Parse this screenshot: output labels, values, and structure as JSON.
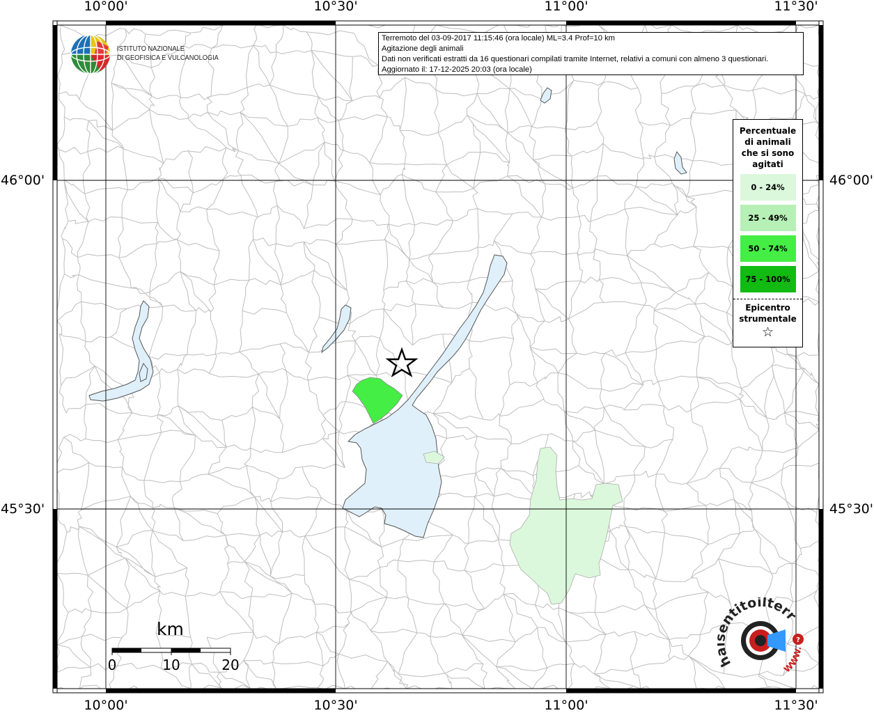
{
  "map": {
    "lon_labels": [
      "10°00'",
      "10°30'",
      "11°00'",
      "11°30'"
    ],
    "lat_labels": [
      "46°00'",
      "45°30'"
    ]
  },
  "info": {
    "line1": "Terremoto del 03-09-2017 11:15:46 (ora locale) ML=3.4 Prof=10 km",
    "line2": "Agitazione degli animali",
    "line3": "Dati non verificati estratti da 16 questionari compilati tramite Internet, relativi a comuni con almeno 3 questionari.",
    "line4": "Aggiornato il: 17-12-2025 20:03 (ora locale)"
  },
  "logo": {
    "line1": "ISTITUTO NAZIONALE",
    "line2": "DI GEOFISICA E VULCANOLOGIA"
  },
  "legend": {
    "title": "Percentuale di animali che si sono agitati",
    "items": [
      {
        "label": "0 - 24%",
        "color": "#dcf8dc"
      },
      {
        "label": "25 - 49%",
        "color": "#b6f0b6"
      },
      {
        "label": "50 - 74%",
        "color": "#44ee44"
      },
      {
        "label": "75 - 100%",
        "color": "#11bb11"
      }
    ],
    "epicenter_title": "Epicentro strumentale",
    "epicenter_symbol": "☆"
  },
  "scalebar": {
    "unit": "km",
    "ticks": [
      "0",
      "10",
      "20"
    ]
  },
  "colors": {
    "lake": "#dff0fb",
    "municipality_border": "#b8b8b8",
    "class_0_24": "#dcf8dc",
    "class_50_74": "#44ee44"
  },
  "watermark": {
    "text": "haisentitoilterremoto.it",
    "url_text": "WWW."
  }
}
